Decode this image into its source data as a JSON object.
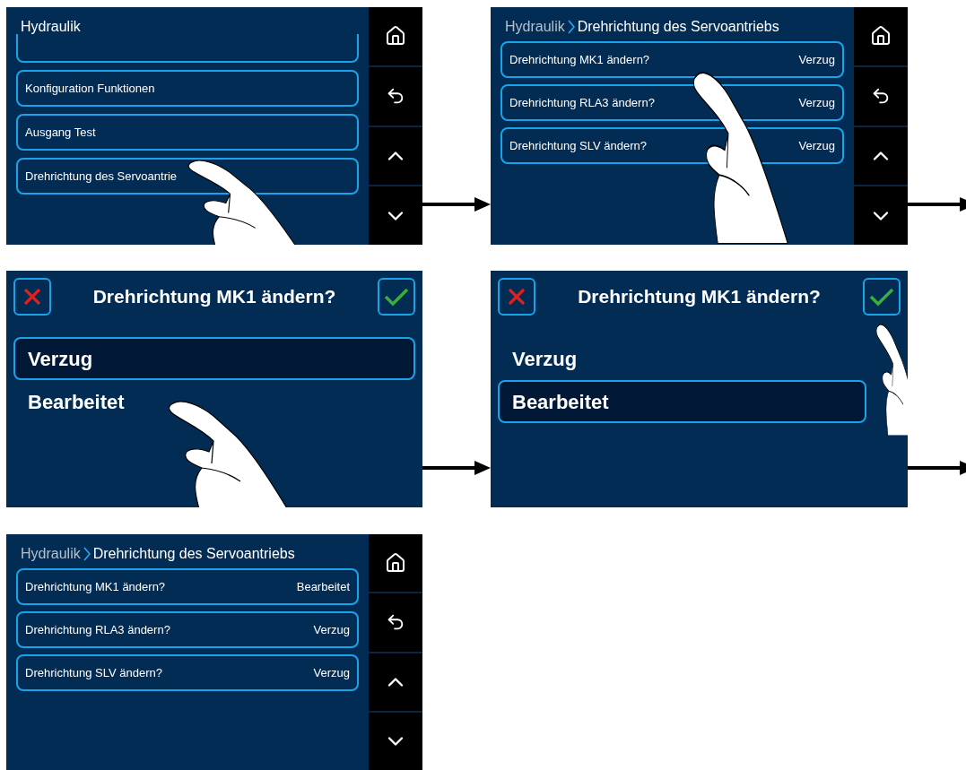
{
  "steps": [
    {
      "kind": "menu",
      "title": "Hydraulik",
      "items": [
        {
          "kind": "clipped"
        },
        {
          "kind": "plain",
          "label": "Konfiguration Funktionen"
        },
        {
          "kind": "plain",
          "label": "Ausgang Test"
        },
        {
          "kind": "plain",
          "label": "Drehrichtung des Servoantrie"
        }
      ]
    },
    {
      "kind": "list",
      "parent": "Hydraulik",
      "title": "Drehrichtung des Servoantriebs",
      "rows": [
        {
          "label": "Drehrichtung MK1 ändern?",
          "value": "Verzug"
        },
        {
          "label": "Drehrichtung RLA3 ändern?",
          "value": "Verzug"
        },
        {
          "label": "Drehrichtung SLV ändern?",
          "value": "Verzug"
        }
      ]
    },
    {
      "kind": "dialog",
      "title": "Drehrichtung MK1 ändern?",
      "options": [
        {
          "label": "Verzug",
          "selected": true
        },
        {
          "label": "Bearbeitet",
          "selected": false
        }
      ]
    },
    {
      "kind": "dialog",
      "title": "Drehrichtung MK1 ändern?",
      "options": [
        {
          "label": "Verzug",
          "selected": false
        },
        {
          "label": "Bearbeitet",
          "selected": true
        }
      ]
    },
    {
      "kind": "list",
      "parent": "Hydraulik",
      "title": "Drehrichtung des Servoantriebs",
      "rows": [
        {
          "label": "Drehrichtung MK1 ändern?",
          "value": "Bearbeitet"
        },
        {
          "label": "Drehrichtung RLA3 ändern?",
          "value": "Verzug"
        },
        {
          "label": "Drehrichtung SLV ändern?",
          "value": "Verzug"
        }
      ]
    }
  ]
}
